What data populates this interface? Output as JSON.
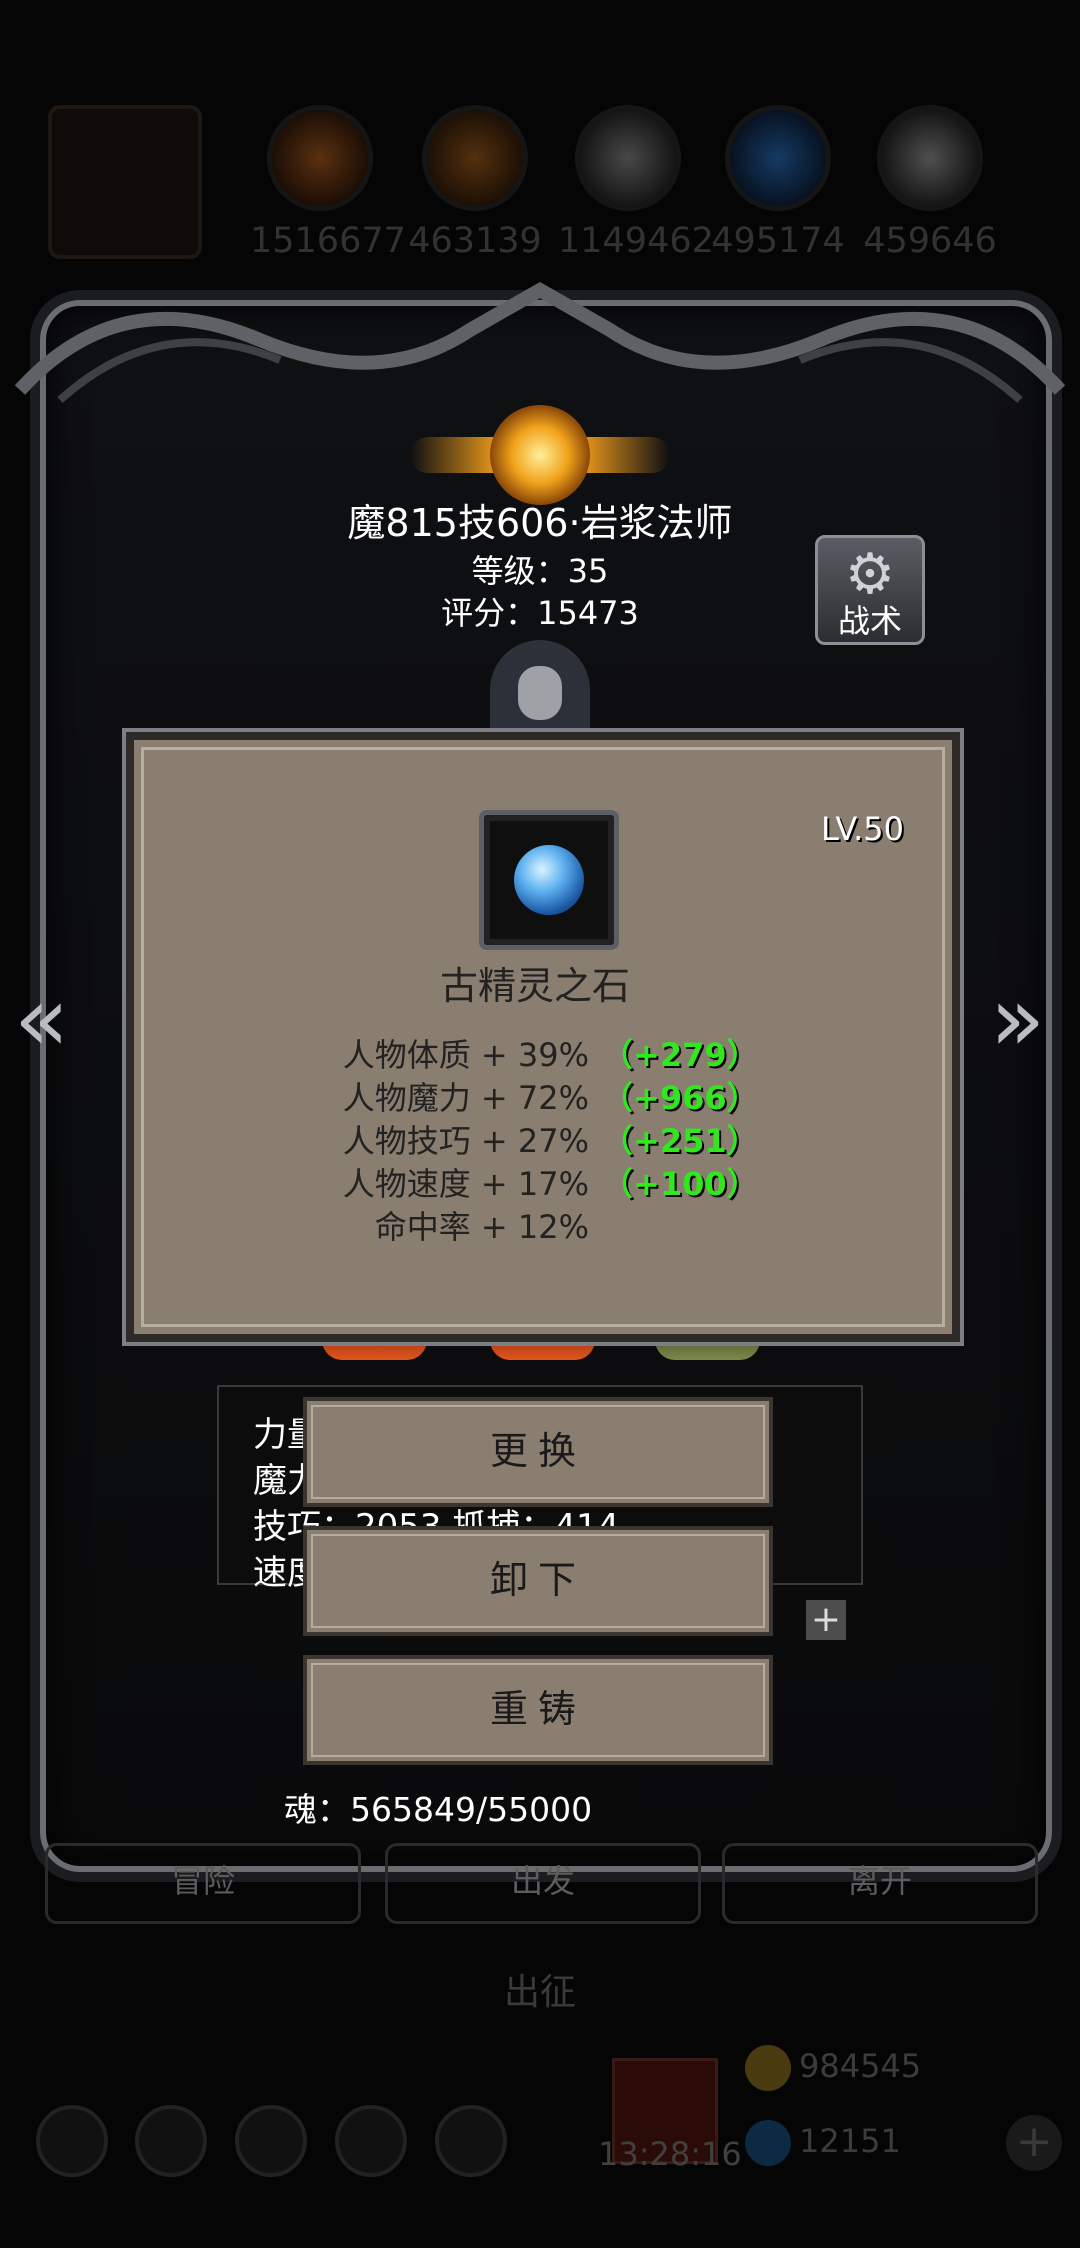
{
  "resources": [
    {
      "icon": "ore-icon",
      "value": "1516677",
      "color": "#c2641f"
    },
    {
      "icon": "wood-icon",
      "value": "463139",
      "color": "#b5651b"
    },
    {
      "icon": "stone-icon",
      "value": "1149462",
      "color": "#9a9a9a"
    },
    {
      "icon": "crystal-icon",
      "value": "495174",
      "color": "#2b7bd6"
    },
    {
      "icon": "iron-icon",
      "value": "459646",
      "color": "#aaaaaa"
    }
  ],
  "hero": {
    "title": "魔815技606·岩浆法师",
    "level": "等级：35",
    "score": "评分：15473",
    "tactics_label": "战术"
  },
  "nav": {
    "prev": "«",
    "next": "»"
  },
  "item": {
    "level": "LV.50",
    "name": "古精灵之石",
    "stats": [
      {
        "text": "人物体质 + 39%",
        "bonus": "（+279）"
      },
      {
        "text": "人物魔力 + 72%",
        "bonus": "（+966）"
      },
      {
        "text": "人物技巧 + 27%",
        "bonus": "（+251）"
      },
      {
        "text": "人物速度 + 17%",
        "bonus": "（+100）"
      },
      {
        "text": "命中率 + 12%",
        "bonus": ""
      }
    ]
  },
  "attributes": {
    "rows": [
      "力量",
      "魔力",
      "技巧：2053      抓捕：414",
      "速度"
    ]
  },
  "actions": {
    "replace": "更换",
    "unequip": "卸下",
    "reforge": "重铸"
  },
  "soul": "魂：565849/55000",
  "bottom_tabs": [
    "冒险",
    "出发",
    "离开"
  ],
  "expedition": "出征",
  "dock": {
    "time": "13:28:16",
    "gold": "984545",
    "gems": "12151",
    "plus": "+"
  },
  "colors": {
    "accent": "#2fe81e",
    "panel": "#8a7e70",
    "frame": "#6a6c70"
  }
}
